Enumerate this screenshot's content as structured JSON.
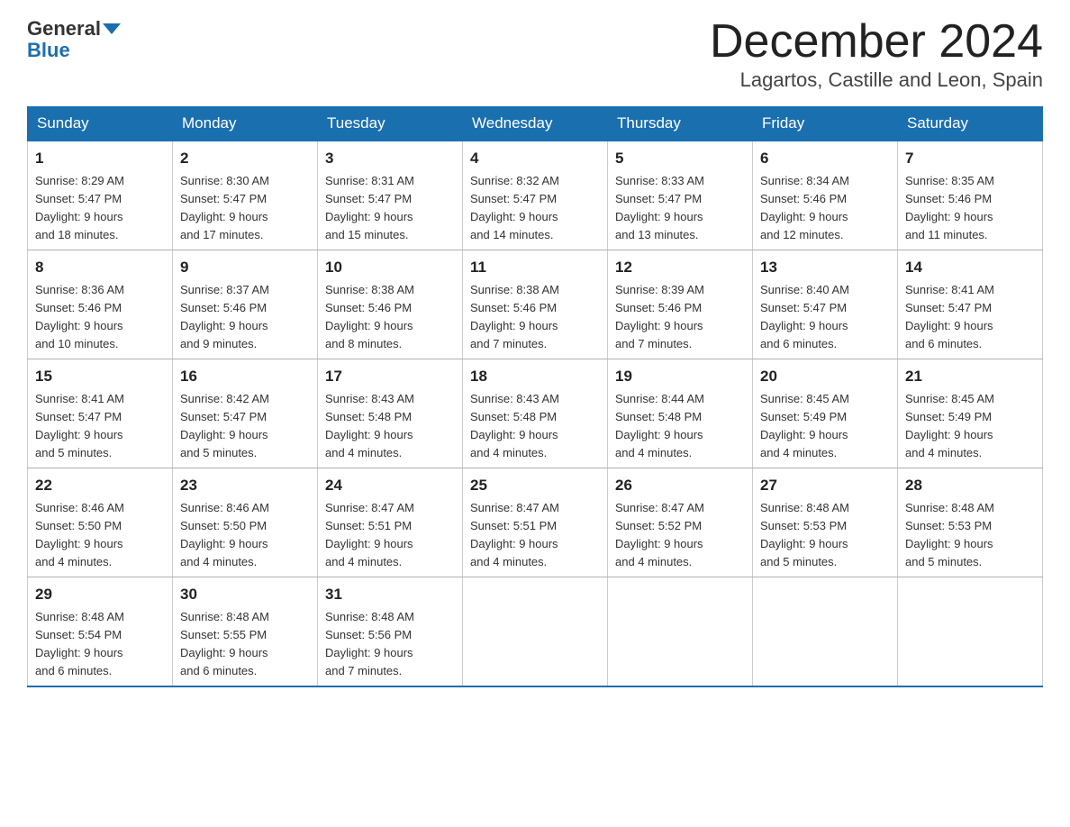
{
  "header": {
    "logo_general": "General",
    "logo_blue": "Blue",
    "month_title": "December 2024",
    "location": "Lagartos, Castille and Leon, Spain"
  },
  "days_of_week": [
    "Sunday",
    "Monday",
    "Tuesday",
    "Wednesday",
    "Thursday",
    "Friday",
    "Saturday"
  ],
  "weeks": [
    [
      {
        "day": "1",
        "sunrise": "8:29 AM",
        "sunset": "5:47 PM",
        "daylight": "9 hours and 18 minutes."
      },
      {
        "day": "2",
        "sunrise": "8:30 AM",
        "sunset": "5:47 PM",
        "daylight": "9 hours and 17 minutes."
      },
      {
        "day": "3",
        "sunrise": "8:31 AM",
        "sunset": "5:47 PM",
        "daylight": "9 hours and 15 minutes."
      },
      {
        "day": "4",
        "sunrise": "8:32 AM",
        "sunset": "5:47 PM",
        "daylight": "9 hours and 14 minutes."
      },
      {
        "day": "5",
        "sunrise": "8:33 AM",
        "sunset": "5:47 PM",
        "daylight": "9 hours and 13 minutes."
      },
      {
        "day": "6",
        "sunrise": "8:34 AM",
        "sunset": "5:46 PM",
        "daylight": "9 hours and 12 minutes."
      },
      {
        "day": "7",
        "sunrise": "8:35 AM",
        "sunset": "5:46 PM",
        "daylight": "9 hours and 11 minutes."
      }
    ],
    [
      {
        "day": "8",
        "sunrise": "8:36 AM",
        "sunset": "5:46 PM",
        "daylight": "9 hours and 10 minutes."
      },
      {
        "day": "9",
        "sunrise": "8:37 AM",
        "sunset": "5:46 PM",
        "daylight": "9 hours and 9 minutes."
      },
      {
        "day": "10",
        "sunrise": "8:38 AM",
        "sunset": "5:46 PM",
        "daylight": "9 hours and 8 minutes."
      },
      {
        "day": "11",
        "sunrise": "8:38 AM",
        "sunset": "5:46 PM",
        "daylight": "9 hours and 7 minutes."
      },
      {
        "day": "12",
        "sunrise": "8:39 AM",
        "sunset": "5:46 PM",
        "daylight": "9 hours and 7 minutes."
      },
      {
        "day": "13",
        "sunrise": "8:40 AM",
        "sunset": "5:47 PM",
        "daylight": "9 hours and 6 minutes."
      },
      {
        "day": "14",
        "sunrise": "8:41 AM",
        "sunset": "5:47 PM",
        "daylight": "9 hours and 6 minutes."
      }
    ],
    [
      {
        "day": "15",
        "sunrise": "8:41 AM",
        "sunset": "5:47 PM",
        "daylight": "9 hours and 5 minutes."
      },
      {
        "day": "16",
        "sunrise": "8:42 AM",
        "sunset": "5:47 PM",
        "daylight": "9 hours and 5 minutes."
      },
      {
        "day": "17",
        "sunrise": "8:43 AM",
        "sunset": "5:48 PM",
        "daylight": "9 hours and 4 minutes."
      },
      {
        "day": "18",
        "sunrise": "8:43 AM",
        "sunset": "5:48 PM",
        "daylight": "9 hours and 4 minutes."
      },
      {
        "day": "19",
        "sunrise": "8:44 AM",
        "sunset": "5:48 PM",
        "daylight": "9 hours and 4 minutes."
      },
      {
        "day": "20",
        "sunrise": "8:45 AM",
        "sunset": "5:49 PM",
        "daylight": "9 hours and 4 minutes."
      },
      {
        "day": "21",
        "sunrise": "8:45 AM",
        "sunset": "5:49 PM",
        "daylight": "9 hours and 4 minutes."
      }
    ],
    [
      {
        "day": "22",
        "sunrise": "8:46 AM",
        "sunset": "5:50 PM",
        "daylight": "9 hours and 4 minutes."
      },
      {
        "day": "23",
        "sunrise": "8:46 AM",
        "sunset": "5:50 PM",
        "daylight": "9 hours and 4 minutes."
      },
      {
        "day": "24",
        "sunrise": "8:47 AM",
        "sunset": "5:51 PM",
        "daylight": "9 hours and 4 minutes."
      },
      {
        "day": "25",
        "sunrise": "8:47 AM",
        "sunset": "5:51 PM",
        "daylight": "9 hours and 4 minutes."
      },
      {
        "day": "26",
        "sunrise": "8:47 AM",
        "sunset": "5:52 PM",
        "daylight": "9 hours and 4 minutes."
      },
      {
        "day": "27",
        "sunrise": "8:48 AM",
        "sunset": "5:53 PM",
        "daylight": "9 hours and 5 minutes."
      },
      {
        "day": "28",
        "sunrise": "8:48 AM",
        "sunset": "5:53 PM",
        "daylight": "9 hours and 5 minutes."
      }
    ],
    [
      {
        "day": "29",
        "sunrise": "8:48 AM",
        "sunset": "5:54 PM",
        "daylight": "9 hours and 6 minutes."
      },
      {
        "day": "30",
        "sunrise": "8:48 AM",
        "sunset": "5:55 PM",
        "daylight": "9 hours and 6 minutes."
      },
      {
        "day": "31",
        "sunrise": "8:48 AM",
        "sunset": "5:56 PM",
        "daylight": "9 hours and 7 minutes."
      },
      null,
      null,
      null,
      null
    ]
  ],
  "labels": {
    "sunrise": "Sunrise:",
    "sunset": "Sunset:",
    "daylight": "Daylight:"
  }
}
